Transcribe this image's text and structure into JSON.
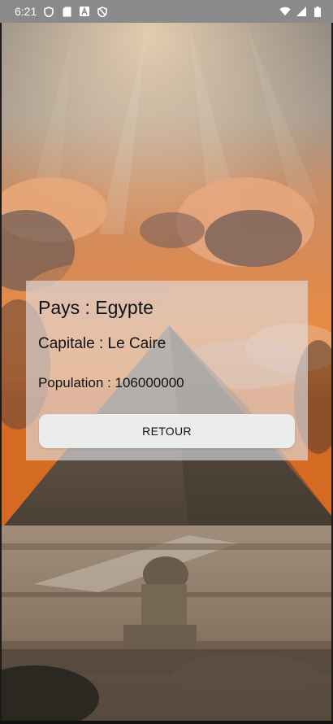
{
  "status_bar": {
    "time": "6:21",
    "left_icons": [
      "shield-icon",
      "sd-card-icon",
      "font-a-icon",
      "blocked-shield-icon"
    ],
    "right_icons": [
      "wifi-icon",
      "signal-icon",
      "battery-icon"
    ]
  },
  "card": {
    "country_text": "Pays : Egypte",
    "capital_text": "Capitale : Le Caire",
    "population_text": "Population : 106000000",
    "back_label": "RETOUR"
  },
  "colors": {
    "status_bar_bg": "#8a8a8a",
    "card_bg": "#e2e2e6",
    "button_bg": "#ebecec"
  }
}
